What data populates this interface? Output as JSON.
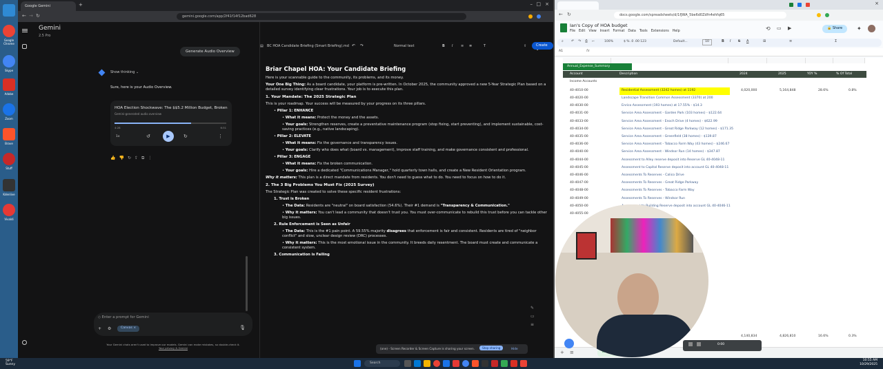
{
  "desktop": {
    "icons": [
      {
        "name": "recycle-bin-icon",
        "color": "#2f8ad4",
        "label": ""
      },
      {
        "name": "chrome-icon",
        "color": "#ea4335",
        "label": "Google Chrome"
      },
      {
        "name": "app-icon-2",
        "color": "#4285f4",
        "label": "Skype"
      },
      {
        "name": "acrobat-icon",
        "color": "#d93025",
        "label": "Adobe"
      },
      {
        "name": "app-icon-4",
        "color": "#1a73e8",
        "label": "Zoom"
      },
      {
        "name": "brave-icon",
        "color": "#fb542b",
        "label": "Brave"
      },
      {
        "name": "app-icon-6",
        "color": "#c62828",
        "label": "Stuff"
      },
      {
        "name": "app-icon-7",
        "color": "#333333",
        "label": "Kdenlive"
      },
      {
        "name": "app-icon-8",
        "color": "#e53935",
        "label": "Vivaldi"
      }
    ]
  },
  "left_browser": {
    "tab_title": "Google Gemini",
    "url": "gemini.google.com/app/2f41f14f12bad628",
    "gemini": {
      "title": "Gemini",
      "model": "2.5 Pro",
      "audio_overview_button": "Generate Audio Overview",
      "show_thinking": "Show thinking",
      "reply_text": "Sure, here is your Audio Overview.",
      "audio_card_title": "HOA Election Shockwave: The $$5.2 Million Budget, Broken ...",
      "audio_card_subtitle": "Gemini-generated audio overview",
      "audio_time_current": "4:28",
      "audio_time_total": "6:31",
      "audio_speed": "1x",
      "prompt_placeholder": "Enter a prompt for Gemini",
      "canvas_chip": "Canvas",
      "disclaimer_line1": "Your Gemini chats aren't used to improve our models. Gemini can make mistakes, so double-check it.",
      "disclaimer_line2": "Your privacy & Gemini"
    },
    "document": {
      "filename": "BC HOA Candidate Briefing (Smart Briefing).md",
      "style_label": "Normal text",
      "create_button": "Create",
      "title": "Briar Chapel HOA: Your Candidate Briefing",
      "intro": "Here is your scannable guide to the community, its problems, and its money.",
      "big_thing_label": "Your One Big Thing:",
      "big_thing_text": "As a board candidate, your platform is pre-written. In October 2025, the community approved a new 5-Year Strategic Plan based on a detailed survey identifying clear frustrations. Your job is to execute this plan.",
      "sec1_title": "1. Your Mandate: The 2025 Strategic Plan",
      "sec1_intro": "This is your roadmap. Your success will be measured by your progress on its three pillars.",
      "p1_title": "Pillar 1: ENHANCE",
      "p1_means_label": "What it means:",
      "p1_means": "Protect the money and the assets.",
      "p1_goals_label": "Your goals:",
      "p1_goals": "Strengthen reserves, create a preventative maintenance program (stop fixing, start preventing), and implement sustainable, cost-saving practices (e.g., native landscaping).",
      "p2_title": "Pillar 2: ELEVATE",
      "p2_means_label": "What it means:",
      "p2_means": "Fix the governance and transparency issues.",
      "p2_goals_label": "Your goals:",
      "p2_goals": "Clarify who does what (board vs. management), improve staff training, and make governance consistent and professional.",
      "p3_title": "Pillar 3: ENGAGE",
      "p3_means_label": "What it means:",
      "p3_means": "Fix the broken communication.",
      "p3_goals_label": "Your goals:",
      "p3_goals": "Hire a dedicated \"Communications Manager,\" hold quarterly town halls, and create a New Resident Orientation program.",
      "why_label": "Why it matters:",
      "why_text": "This plan is a direct mandate from residents. You don't need to guess what to do. You need to focus on how to do it.",
      "sec2_title": "2. The 3 Big Problems You Must Fix (2025 Survey)",
      "sec2_intro": "The Strategic Plan was created to solve these specific resident frustrations:",
      "prob1_title": "1. Trust is Broken",
      "prob1_data_label": "The Data:",
      "prob1_data": "Residents are \"neutral\" on board satisfaction (54.6%). Their #1 demand is ",
      "prob1_data_bold": "\"Transparency & Communication.\"",
      "prob1_why_label": "Why it matters:",
      "prob1_why": "You can't lead a community that doesn't trust you. You must over-communicate to rebuild this trust before you can tackle other big issues.",
      "prob2_title": "2. Rule Enforcement is Seen as Unfair",
      "prob2_data_label": "The Data:",
      "prob2_data": "This is the #1 pain point. A 59.55% majority ",
      "prob2_data_bold": "disagrees",
      "prob2_data_rest": " that enforcement is fair and consistent. Residents are tired of \"neighbor conflict\" and slow, unclear design review (DRC) processes.",
      "prob2_why_label": "Why it matters:",
      "prob2_why": "This is the most emotional issue in the community. It breeds daily resentment. The board must create and communicate a consistent system.",
      "prob3_title": "3. Communication is Failing",
      "share_notice": "(one) - Screen Recorder & Screen Capture is sharing your screen.",
      "stop_sharing": "Stop sharing",
      "hide": "Hide"
    }
  },
  "right_browser": {
    "url": "docs.google.com/spreadsheets/d/1fJWA_5be6d0Zdfn4ehfq65",
    "sheet_title": "Ian's Copy of HOA budget",
    "menus": [
      "File",
      "Edit",
      "View",
      "Insert",
      "Format",
      "Data",
      "Tools",
      "Extensions",
      "Help"
    ],
    "share": "Share",
    "zoom": "100%",
    "font": "Default...",
    "font_size": "10",
    "cell_ref": "A1",
    "headers": {
      "account": "Account",
      "description": "Description",
      "y2024": "2024",
      "y2025": "2025",
      "yoy": "YOY %",
      "of_total": "% Of Total"
    },
    "filter_label": "Annual_Expense_Summary",
    "income_label": "Income Accounts",
    "highlight_row": {
      "account": "40-4010-00",
      "description": "Residential Assessment (3242 homes) at 1192",
      "y2024": "4,020,000",
      "y2025": "5,164,848",
      "yoy": "28.6%",
      "of_total": "0.8%"
    },
    "rows": [
      {
        "account": "40-4020-00",
        "description": "Landscape Transition Common Assessment (3370) at 200"
      },
      {
        "account": "40-4030-00",
        "description": "Enrico Assessment (193 homes) at 17.55% - $14.3"
      },
      {
        "account": "40-4031-00",
        "description": "Service Area Assessment - Garden Park (103 homes) - $122.64"
      },
      {
        "account": "40-4033-00",
        "description": "Service Area Assessment - Enoch Drive (4 homes) - $622.99"
      },
      {
        "account": "40-4034-00",
        "description": "Service Area Assessment - Great Ridge Parkway (12 homes) - $171.35"
      },
      {
        "account": "40-4035-00",
        "description": "Service Area Assessment - Greenfield (38 homes) - $139.87"
      },
      {
        "account": "40-4036-00",
        "description": "Service Area Assessment - Tobacco Farm Way (43 homes) - $246.67"
      },
      {
        "account": "40-4040-00",
        "description": "Service Area Assessment - Windsor Run (14 homes) - $347.87"
      },
      {
        "account": "40-4044-00",
        "description": "Assessment to Alley reserve deposit into Reserve GL 40-4048-11"
      },
      {
        "account": "40-4045-00",
        "description": "Assessment to Capital Reserve deposit into account GL 40-4048-11"
      },
      {
        "account": "40-4046-00",
        "description": "Assessments To Reserves - Calico Drive"
      },
      {
        "account": "40-4047-00",
        "description": "Assessments To Reserves - Great Ridge Parkway"
      },
      {
        "account": "40-4048-00",
        "description": "Assessments To Reserves - Tobacco Farm Way"
      },
      {
        "account": "40-4049-00",
        "description": "Assessments To Reserves - Windsor Run"
      },
      {
        "account": "40-4050-00",
        "description": "Assessment to Building Reserve deposit into account GL 40-4046-11"
      },
      {
        "account": "40-4055-00",
        "description": "... 397 homes) at 84.50"
      }
    ],
    "totals": {
      "y2024": "4,140,834",
      "y2025": "4,826,810",
      "yoy": "16.6%",
      "of_total": "0.3%"
    },
    "sheet_tab": "Total Inco...",
    "cam_time": "0:00"
  },
  "taskbar": {
    "weather": "59°F",
    "weather_desc": "Sunny",
    "search": "Search",
    "time": "10:55 AM",
    "date": "10/29/2025"
  },
  "colors": {
    "accent_blue": "#0b57d0",
    "sheet_green": "#188038",
    "highlight_yellow": "#ffff00",
    "gemini_bg": "#131314"
  }
}
